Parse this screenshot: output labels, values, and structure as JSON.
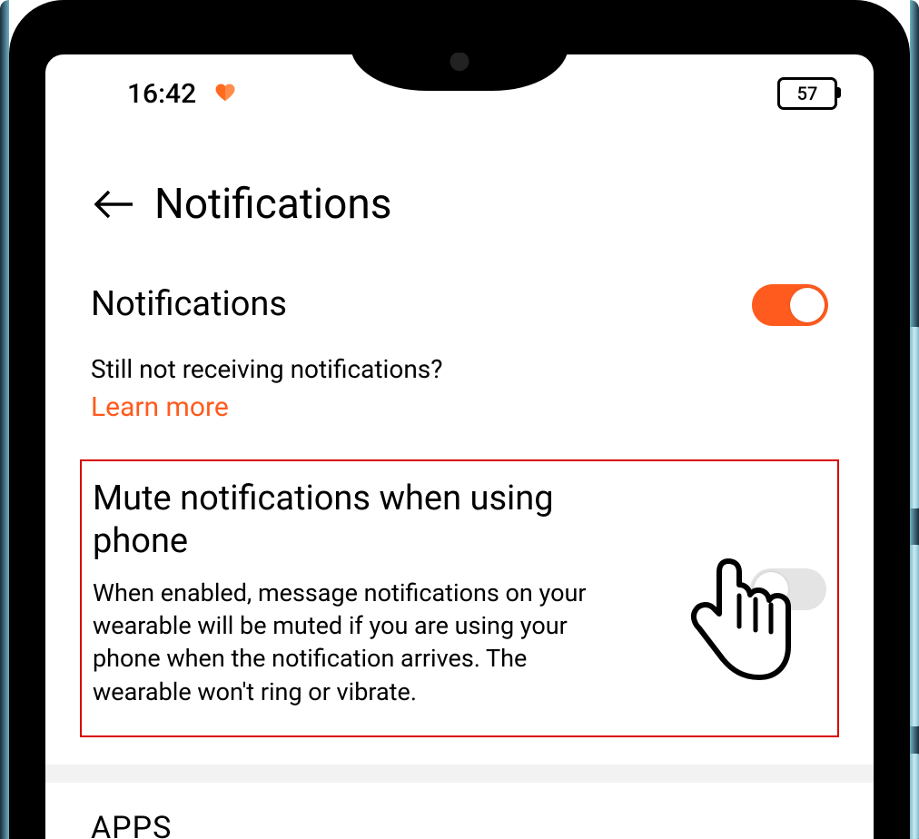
{
  "statusbar": {
    "time": "16:42",
    "battery_level": "57"
  },
  "header": {
    "title": "Notifications"
  },
  "notifications_row": {
    "label": "Notifications",
    "toggle_on": true
  },
  "help": {
    "question": "Still not receiving notifications?",
    "link_label": "Learn more"
  },
  "mute_row": {
    "title": "Mute notifications when using phone",
    "description": "When enabled, message notifications on your wearable will be muted if you are using your phone when the notification arrives. The wearable won't ring or vibrate.",
    "toggle_on": false
  },
  "apps_section_header": "APPS",
  "colors": {
    "accent": "#ff5b1e",
    "highlight_border": "#d80000"
  }
}
